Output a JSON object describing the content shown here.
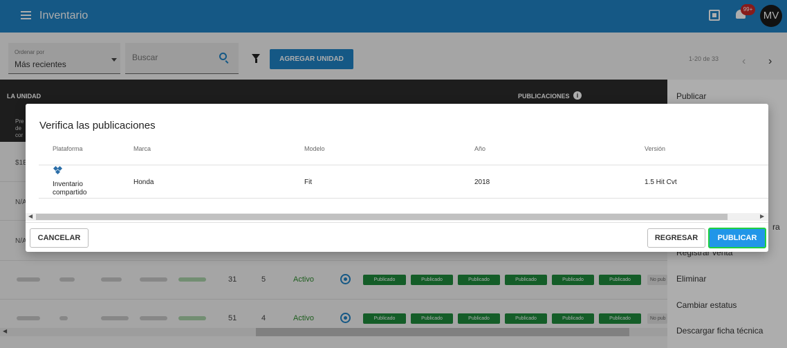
{
  "app": {
    "title": "Inventario",
    "notif_count": "99+",
    "avatar_initials": "MV"
  },
  "toolbar": {
    "sort_label": "Ordenar por",
    "sort_value": "Más recientes",
    "search_placeholder": "Buscar",
    "add_button": "AGREGAR UNIDAD",
    "pagination": "1-20 de 33"
  },
  "table": {
    "col_unit": "LA UNIDAD",
    "col_publications": "PUBLICACIONES",
    "subheader": [
      "Pre",
      "de",
      "cor"
    ],
    "left_cells": [
      "$1E",
      "N/A",
      "N/A"
    ],
    "rows": [
      {
        "n1": "31",
        "n2": "5",
        "status": "Activo",
        "pubs": [
          "Publicado",
          "Publicado",
          "Publicado",
          "Publicado",
          "Publicado",
          "Publicado"
        ],
        "nopub": "No pub"
      },
      {
        "n1": "51",
        "n2": "4",
        "status": "Activo",
        "pubs": [
          "Publicado",
          "Publicado",
          "Publicado",
          "Publicado",
          "Publicado",
          "Publicado"
        ],
        "nopub": "No pub"
      }
    ]
  },
  "side_menu": {
    "items": [
      "Publicar",
      "ra",
      "Registrar venta",
      "Eliminar",
      "Cambiar estatus",
      "Descargar ficha técnica"
    ]
  },
  "dialog": {
    "title": "Verifica las publicaciones",
    "headers": [
      "Plataforma",
      "Marca",
      "Modelo",
      "Año",
      "Versión"
    ],
    "row": {
      "platform": "Inventario compartido",
      "brand": "Honda",
      "model": "Fit",
      "year": "2018",
      "version": "1.5 Hit Cvt"
    },
    "cancel": "CANCELAR",
    "back": "REGRESAR",
    "publish": "PUBLICAR"
  },
  "colors": {
    "primary": "#1f82c4",
    "published": "#1e8a3c",
    "focus": "#20d040"
  }
}
